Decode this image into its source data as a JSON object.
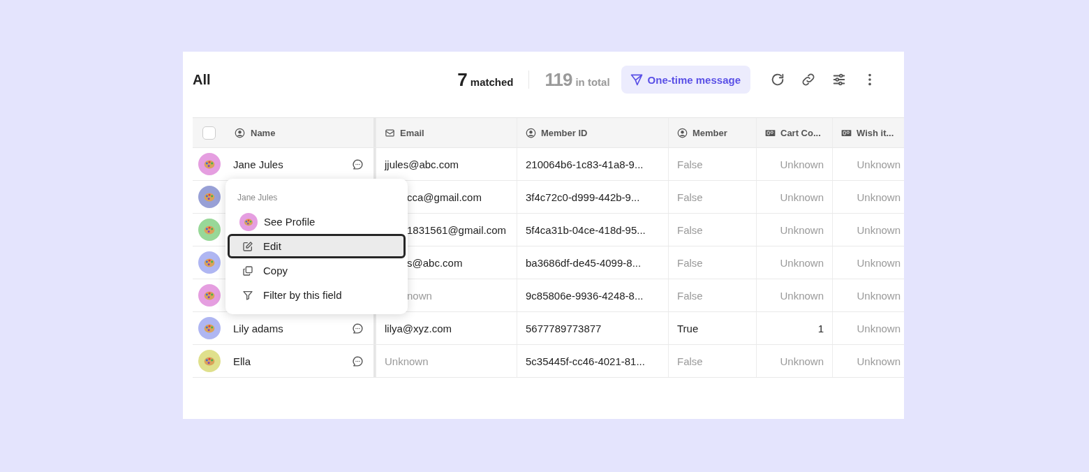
{
  "view_title": "All",
  "matched": {
    "count": "7",
    "label": "matched"
  },
  "total": {
    "count": "119",
    "label": "in total"
  },
  "message_button": "One-time message",
  "select_all": {
    "checked": false
  },
  "columns": [
    {
      "label": "Name",
      "kind": "person"
    },
    {
      "label": "Email",
      "kind": "mail"
    },
    {
      "label": "Member ID",
      "kind": "person"
    },
    {
      "label": "Member",
      "kind": "person"
    },
    {
      "label": "Cart Co...",
      "kind": "number"
    },
    {
      "label": "Wish it...",
      "kind": "number"
    }
  ],
  "rows": [
    {
      "color": "#e59ee0",
      "name": "Jane Jules",
      "email": {
        "text": "jjules@abc.com",
        "muted": false,
        "clipped": false
      },
      "member_id": "210064b6-1c83-41a8-9...",
      "member": {
        "text": "False",
        "muted": true
      },
      "cart": {
        "text": "Unknown",
        "muted": true
      },
      "wish": {
        "text": "Unknown",
        "muted": true
      }
    },
    {
      "color": "#98a0d6",
      "email": {
        "text": "cca@gmail.com",
        "muted": false,
        "clipped": true
      },
      "member_id": "3f4c72c0-d999-442b-9...",
      "member": {
        "text": "False",
        "muted": true
      },
      "cart": {
        "text": "Unknown",
        "muted": true
      },
      "wish": {
        "text": "Unknown",
        "muted": true
      }
    },
    {
      "color": "#98d898",
      "email": {
        "text": "1831561@gmail.com",
        "muted": false,
        "clipped": true
      },
      "member_id": "5f4ca31b-04ce-418d-95...",
      "member": {
        "text": "False",
        "muted": true
      },
      "cart": {
        "text": "Unknown",
        "muted": true
      },
      "wish": {
        "text": "Unknown",
        "muted": true
      }
    },
    {
      "color": "#afb6f2",
      "email": {
        "text": "s@abc.com",
        "muted": false,
        "clipped": true
      },
      "member_id": "ba3686df-de45-4099-8...",
      "member": {
        "text": "False",
        "muted": true
      },
      "cart": {
        "text": "Unknown",
        "muted": true
      },
      "wish": {
        "text": "Unknown",
        "muted": true
      }
    },
    {
      "color": "#e59ee0",
      "email": {
        "text": "nown",
        "muted": true,
        "clipped": true
      },
      "member_id": "9c85806e-9936-4248-8...",
      "member": {
        "text": "False",
        "muted": true
      },
      "cart": {
        "text": "Unknown",
        "muted": true
      },
      "wish": {
        "text": "Unknown",
        "muted": true
      }
    },
    {
      "color": "#afb6f2",
      "name": "Lily adams",
      "email": {
        "text": "lilya@xyz.com",
        "muted": false,
        "clipped": false
      },
      "member_id": "5677789773877",
      "member": {
        "text": "True",
        "muted": false
      },
      "cart": {
        "text": "1",
        "muted": false
      },
      "wish": {
        "text": "Unknown",
        "muted": true
      }
    },
    {
      "color": "#dfe08c",
      "name": "Ella",
      "email": {
        "text": "Unknown",
        "muted": true,
        "clipped": false
      },
      "member_id": "5c35445f-cc46-4021-81...",
      "member": {
        "text": "False",
        "muted": true
      },
      "cart": {
        "text": "Unknown",
        "muted": true
      },
      "wish": {
        "text": "Unknown",
        "muted": true
      }
    }
  ],
  "context_menu": {
    "title": "Jane Jules",
    "color": "#e59ee0",
    "items": [
      {
        "label": "See Profile",
        "kind": "avatar",
        "selected": false
      },
      {
        "label": "Edit",
        "kind": "pencil",
        "selected": true
      },
      {
        "label": "Copy",
        "kind": "copy",
        "selected": false
      },
      {
        "label": "Filter by this field",
        "kind": "filter",
        "selected": false
      }
    ]
  }
}
